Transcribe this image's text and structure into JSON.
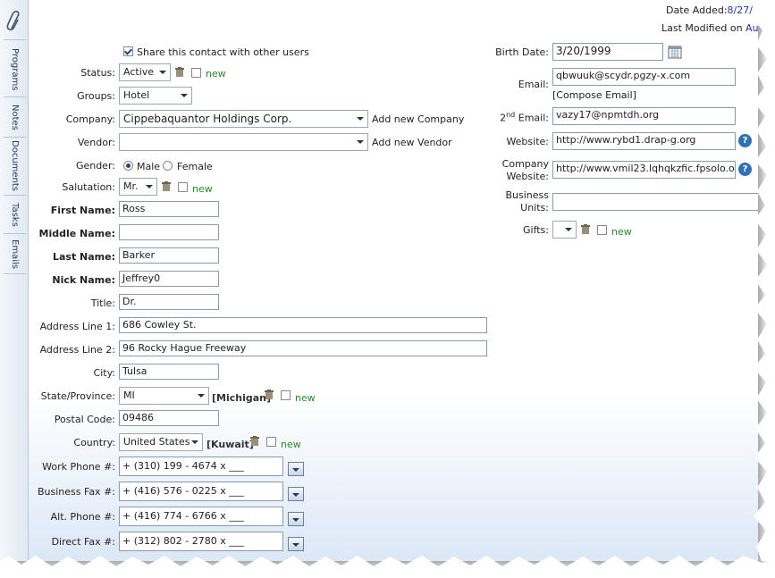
{
  "tabs": [
    "Programs",
    "Notes",
    "Documents",
    "Tasks",
    "Emails"
  ],
  "header": {
    "date_added_label": "Date Added:",
    "date_added_value": "8/27/",
    "last_modified_label": "Last Modified on",
    "last_modified_value": "Au"
  },
  "share": {
    "label": "Share this contact with other users",
    "checked": true
  },
  "form": {
    "status": {
      "label": "Status:",
      "value": "Active",
      "new_label": "new"
    },
    "groups": {
      "label": "Groups:",
      "value": "Hotel"
    },
    "company": {
      "label": "Company:",
      "value": "Cippebaquantor Holdings Corp.",
      "add_label": "Add new Company"
    },
    "vendor": {
      "label": "Vendor:",
      "value": "",
      "add_label": "Add new Vendor"
    },
    "gender": {
      "label": "Gender:",
      "options": [
        "Male",
        "Female"
      ],
      "selected": "Male"
    },
    "salutation": {
      "label": "Salutation:",
      "value": "Mr.",
      "new_label": "new"
    },
    "first_name": {
      "label": "First Name:",
      "value": "Ross"
    },
    "middle_name": {
      "label": "Middle Name:",
      "value": ""
    },
    "last_name": {
      "label": "Last Name:",
      "value": "Barker"
    },
    "nick_name": {
      "label": "Nick Name:",
      "value": "Jeffrey0"
    },
    "title": {
      "label": "Title:",
      "value": "Dr."
    },
    "address1": {
      "label": "Address Line 1:",
      "value": "686 Cowley St."
    },
    "address2": {
      "label": "Address Line 2:",
      "value": "96 Rocky Hague Freeway"
    },
    "city": {
      "label": "City:",
      "value": "Tulsa"
    },
    "state": {
      "label": "State/Province:",
      "value": "MI",
      "display": "[Michigan]",
      "new_label": "new"
    },
    "postal": {
      "label": "Postal Code:",
      "value": "09486"
    },
    "country": {
      "label": "Country:",
      "value": "United States",
      "display": "[Kuwait]",
      "new_label": "new"
    },
    "work_phone": {
      "label": "Work Phone #:",
      "value": "+ (310) 199 - 4674 x ___"
    },
    "business_fax": {
      "label": "Business Fax #:",
      "value": "+ (416) 576 - 0225 x ___"
    },
    "alt_phone": {
      "label": "Alt. Phone #:",
      "value": "+ (416) 774 - 6766 x ___"
    },
    "direct_fax": {
      "label": "Direct Fax #:",
      "value": "+ (312) 802 - 2780 x ___"
    }
  },
  "right": {
    "birth_date": {
      "label": "Birth Date:",
      "value": "3/20/1999"
    },
    "email": {
      "label": "Email:",
      "value": "qbwuuk@scydr.pgzy-x.com",
      "compose": "[Compose Email]"
    },
    "email2": {
      "label_sup": "nd",
      "label_pre": "2",
      "label_post": " Email:",
      "value": "vazy17@npmtdh.org"
    },
    "website": {
      "label": "Website:",
      "value": "http://www.rybd1.drap-g.org"
    },
    "company_website": {
      "label_line1": "Company",
      "label_line2": "Website:",
      "value": "http://www.vmil23.lqhqkzfic.fpsolo.org"
    },
    "business_units": {
      "label_line1": "Business",
      "label_line2": "Units:",
      "value": ""
    },
    "gifts": {
      "label": "Gifts:",
      "new_label": "new"
    }
  },
  "icons": {
    "help": "?"
  }
}
